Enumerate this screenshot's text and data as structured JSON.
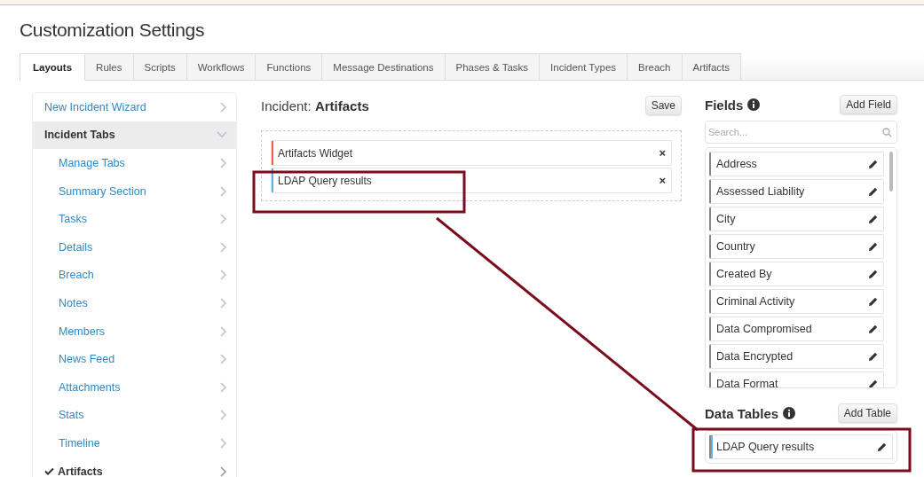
{
  "page": {
    "title": "Customization Settings"
  },
  "tabs": [
    {
      "label": "Layouts",
      "selected": true
    },
    {
      "label": "Rules",
      "selected": false
    },
    {
      "label": "Scripts",
      "selected": false
    },
    {
      "label": "Workflows",
      "selected": false
    },
    {
      "label": "Functions",
      "selected": false
    },
    {
      "label": "Message Destinations",
      "selected": false
    },
    {
      "label": "Phases & Tasks",
      "selected": false
    },
    {
      "label": "Incident Types",
      "selected": false
    },
    {
      "label": "Breach",
      "selected": false
    },
    {
      "label": "Artifacts",
      "selected": false
    }
  ],
  "sidebar": {
    "items": [
      {
        "label": "New Incident Wizard",
        "kind": "link"
      },
      {
        "label": "Incident Tabs",
        "kind": "group",
        "expanded": true,
        "children": [
          {
            "label": "Manage Tabs",
            "checked": false
          },
          {
            "label": "Summary Section",
            "checked": false
          },
          {
            "label": "Tasks",
            "checked": false
          },
          {
            "label": "Details",
            "checked": false
          },
          {
            "label": "Breach",
            "checked": false
          },
          {
            "label": "Notes",
            "checked": false
          },
          {
            "label": "Members",
            "checked": false
          },
          {
            "label": "News Feed",
            "checked": false
          },
          {
            "label": "Attachments",
            "checked": false
          },
          {
            "label": "Stats",
            "checked": false
          },
          {
            "label": "Timeline",
            "checked": false
          },
          {
            "label": "Artifacts",
            "checked": true
          }
        ]
      }
    ]
  },
  "layout_editor": {
    "heading_prefix": "Incident:",
    "heading_name": "Artifacts",
    "save_button": "Save",
    "widgets": [
      {
        "label": "Artifacts Widget",
        "color": "#e8604c",
        "remove": "×"
      },
      {
        "label": "LDAP Query results",
        "color": "#5bb4e8",
        "remove": "×"
      }
    ]
  },
  "fields_panel": {
    "title": "Fields",
    "add_button": "Add Field",
    "search": {
      "placeholder": "Search..."
    },
    "fields": [
      "Address",
      "Assessed Liability",
      "City",
      "Country",
      "Created By",
      "Criminal Activity",
      "Data Compromised",
      "Data Encrypted",
      "Data Format"
    ]
  },
  "data_tables": {
    "title": "Data Tables",
    "add_button": "Add Table",
    "tables": [
      {
        "label": "LDAP Query results",
        "color": "#5bb4e8"
      }
    ]
  }
}
